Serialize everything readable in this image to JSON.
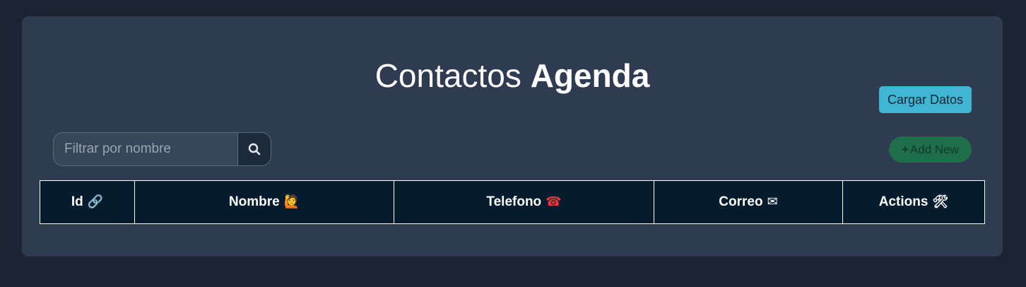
{
  "header": {
    "title_part1": "Contactos ",
    "title_part2": "Agenda"
  },
  "toolbar": {
    "load_label": "Cargar Datos",
    "add_label": "Add New",
    "add_icon": "plus-icon"
  },
  "search": {
    "placeholder": "Filtrar por nombre",
    "value": "",
    "icon": "search-icon"
  },
  "table": {
    "columns": [
      {
        "label": "Id",
        "emoji": "🔗"
      },
      {
        "label": "Nombre",
        "emoji": "🙋"
      },
      {
        "label": "Telefono",
        "emoji": "☎"
      },
      {
        "label": "Correo",
        "emoji": "✉"
      },
      {
        "label": "Actions",
        "emoji": "🛠"
      }
    ]
  },
  "colors": {
    "background": "#1c2333",
    "card": "#2e3b50",
    "load_button": "#3fb6d3",
    "add_button": "#1f6e4a",
    "table_header": "#051c2f"
  }
}
